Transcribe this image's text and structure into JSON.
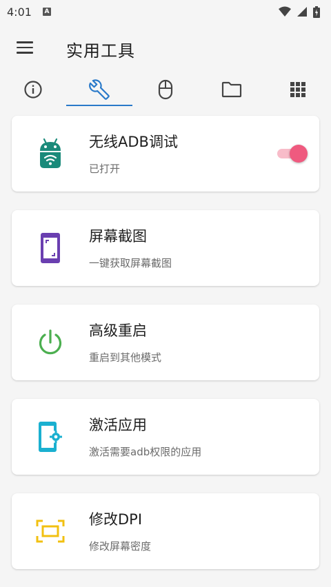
{
  "status_bar": {
    "time": "4:01",
    "notification_letter": "A"
  },
  "app_bar": {
    "title": "实用工具",
    "menu_icon": "menu-icon"
  },
  "tabs": [
    {
      "icon": "info-icon",
      "active": false
    },
    {
      "icon": "wrench-icon",
      "active": true
    },
    {
      "icon": "mouse-icon",
      "active": false
    },
    {
      "icon": "folder-icon",
      "active": false
    },
    {
      "icon": "grid-icon",
      "active": false
    }
  ],
  "colors": {
    "accent": "#2979c9",
    "toggle_on": "#ef5a7f",
    "adb_icon": "#1a8a7a",
    "screenshot_icon": "#6a3fb0",
    "reboot_icon": "#4caf50",
    "activate_icon": "#1ab0d0",
    "dpi_icon": "#f2c010"
  },
  "cards": [
    {
      "title": "无线ADB调试",
      "subtitle": "已打开",
      "icon": "android-wifi-icon",
      "toggle_on": true
    },
    {
      "title": "屏幕截图",
      "subtitle": "一键获取屏幕截图",
      "icon": "screenshot-icon"
    },
    {
      "title": "高级重启",
      "subtitle": "重启到其他模式",
      "icon": "power-icon"
    },
    {
      "title": "激活应用",
      "subtitle": "激活需要adb权限的应用",
      "icon": "phone-settings-icon"
    },
    {
      "title": "修改DPI",
      "subtitle": "修改屏幕密度",
      "icon": "dpi-icon"
    }
  ]
}
